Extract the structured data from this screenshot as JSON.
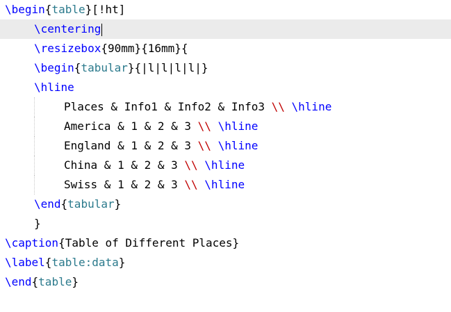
{
  "editor": {
    "lines": [
      {
        "cmd": "\\begin",
        "arg": "table",
        "rest": "[!ht]"
      },
      {
        "cmd": "\\centering"
      },
      {
        "cmd": "\\resizebox",
        "rest": "{90mm}{16mm}{"
      },
      {
        "cmd": "\\begin",
        "arg": "tabular",
        "rest": "{|l|l|l|l|}"
      },
      {
        "cmd": "\\hline"
      },
      {
        "text": "Places & Info1 & Info2 & Info3 ",
        "br": "\\\\",
        "cmd": "\\hline"
      },
      {
        "text": "America & 1 & 2 & 3 ",
        "br": "\\\\",
        "cmd": "\\hline"
      },
      {
        "text": "England & 1 & 2 & 3 ",
        "br": "\\\\",
        "cmd": "\\hline"
      },
      {
        "text": "China & 1 & 2 & 3 ",
        "br": "\\\\",
        "cmd": "\\hline"
      },
      {
        "text": "Swiss & 1 & 2 & 3 ",
        "br": "\\\\",
        "cmd": "\\hline"
      },
      {
        "cmd": "\\end",
        "arg": "tabular"
      },
      {
        "text": "}"
      },
      {
        "cmd": "\\caption",
        "rest": "{Table of Different Places}"
      },
      {
        "cmd": "\\label",
        "arg": "table:data"
      },
      {
        "cmd": "\\end",
        "arg": "table"
      }
    ]
  }
}
